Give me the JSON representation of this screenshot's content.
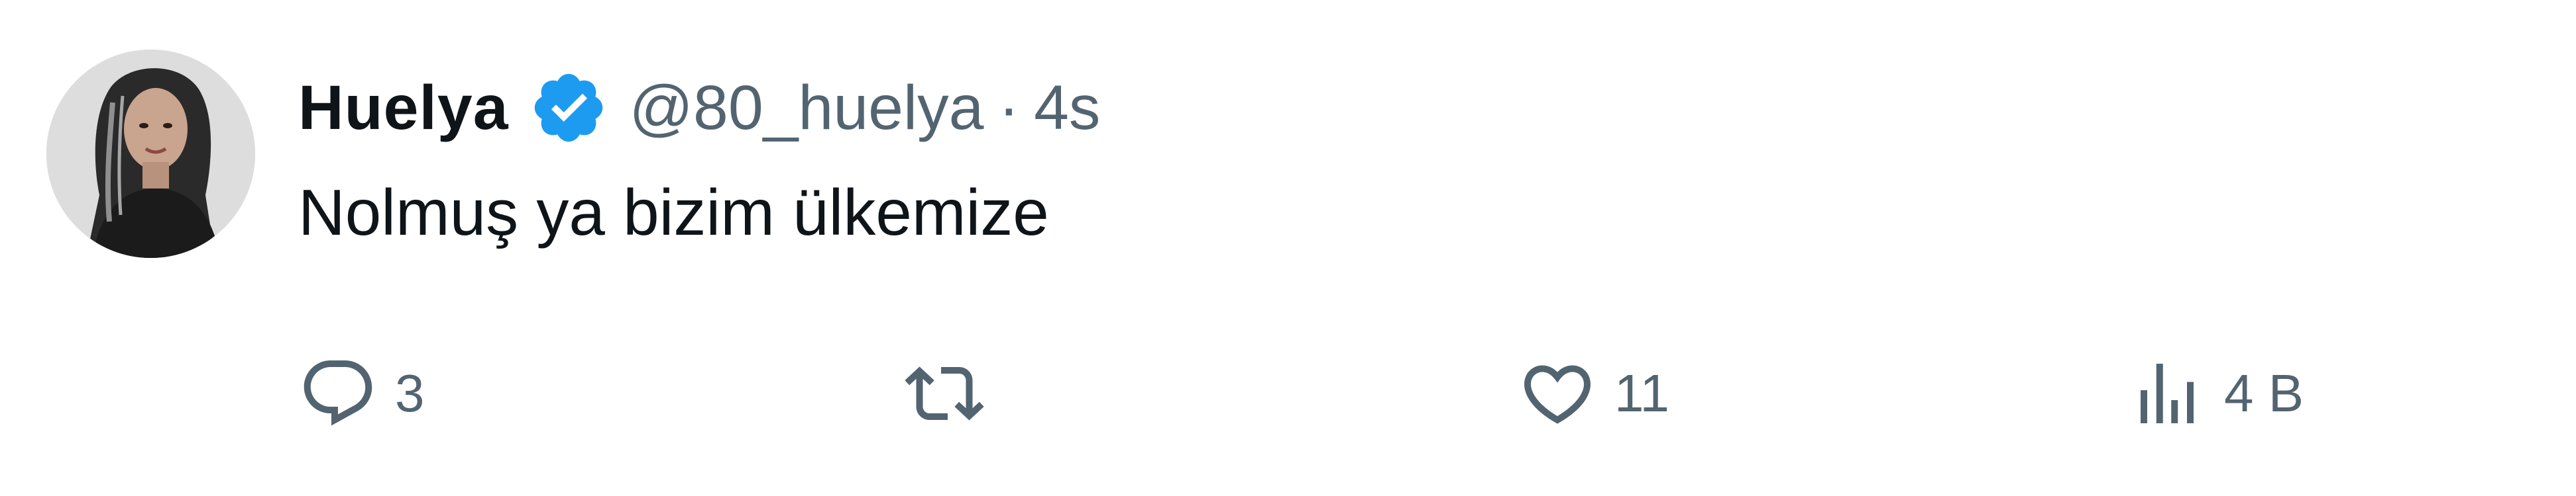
{
  "tweet": {
    "display_name": "Huelya",
    "handle": "@80_huelya",
    "separator": "·",
    "time": "4s",
    "text": "Nolmuş ya bizim ülkemize",
    "verified": true
  },
  "actions": {
    "reply_count": "3",
    "retweet_count": "",
    "like_count": "11",
    "views_count": "4 B"
  },
  "icons": {
    "verified": "verified-badge-icon",
    "reply": "speech-bubble-icon",
    "retweet": "retweet-arrows-icon",
    "like": "heart-icon",
    "views": "bar-chart-icon"
  },
  "colors": {
    "text_primary": "#0f1419",
    "text_secondary": "#536471",
    "verified_blue": "#1d9bf0",
    "background": "#ffffff"
  }
}
